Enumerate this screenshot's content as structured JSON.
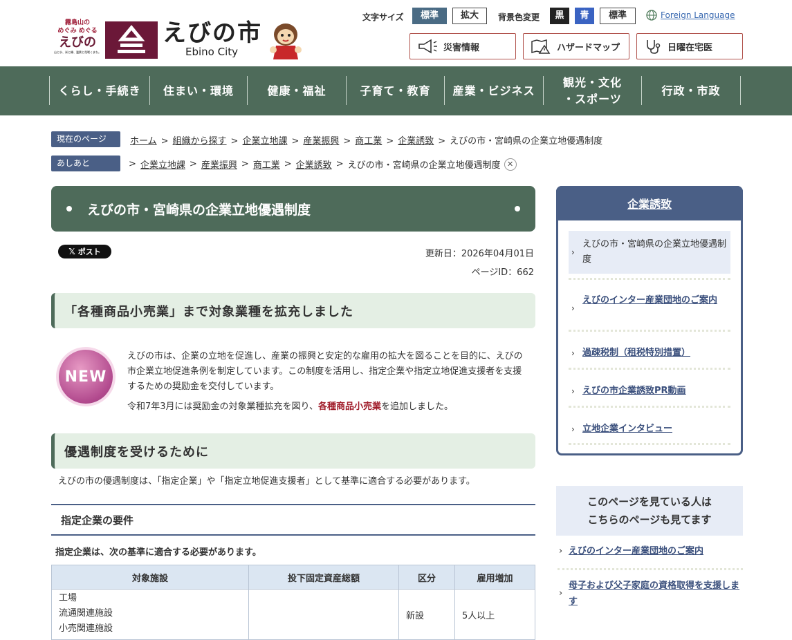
{
  "header": {
    "slogan_top": "霧島山の",
    "slogan_mid": "めぐみ めぐる",
    "slogan_city": "えびの",
    "slogan_small": "山と水、米と緑、温泉と花咲くまち。",
    "city_name": "えびの市",
    "city_name_en": "Ebino City",
    "font_size_label": "文字サイズ",
    "font_size_options": [
      "標準",
      "拡大"
    ],
    "bg_color_label": "背景色変更",
    "bg_color_options": [
      "黒",
      "青",
      "標準"
    ],
    "foreign_language": "Foreign Language",
    "service_buttons": [
      {
        "label": "災害情報",
        "icon": "megaphone-icon"
      },
      {
        "label": "ハザードマップ",
        "icon": "map-warning-icon"
      },
      {
        "label": "日曜在宅医",
        "icon": "stethoscope-icon"
      }
    ]
  },
  "nav": {
    "items": [
      "くらし・手続き",
      "住まい・環境",
      "健康・福祉",
      "子育て・教育",
      "産業・ビジネス",
      "観光・文化\n・スポーツ",
      "行政・市政"
    ]
  },
  "breadcrumb": {
    "current_label": "現在のページ",
    "current_links": [
      "ホーム",
      "組織から探す",
      "企業立地課",
      "産業振興",
      "商工業",
      "企業誘致"
    ],
    "current_page": "えびの市・宮崎県の企業立地優遇制度",
    "history_label": "あしあと",
    "history_links": [
      "企業立地課",
      "産業振興",
      "商工業",
      "企業誘致"
    ],
    "history_page": "えびの市・宮崎県の企業立地優遇制度"
  },
  "main": {
    "title": "えびの市・宮崎県の企業立地優遇制度",
    "x_post": "ポスト",
    "updated": "更新日：2026年04月01日",
    "page_id": "ページID：662",
    "section1_title": "「各種商品小売業」まで対象業種を拡充しました",
    "new_badge": "NEW",
    "intro": "えびの市は、企業の立地を促進し、産業の振興と安定的な雇用の拡大を図ることを目的に、えびの市企業立地促進条例を制定しています。この制度を活用し、指定企業や指定立地促進支援者を支援するための奨励金を交付しています。",
    "notice_before": "令和7年3月には奨励金の対象業種拡充を図り、",
    "notice_highlight": "各種商品小売業",
    "notice_after": "を追加しました。",
    "section2_title": "優遇制度を受けるために",
    "section2_text": "えびの市の優遇制度は、「指定企業」や「指定立地促進支援者」として基準に適合する必要があります。",
    "section3_title": "指定企業の要件",
    "section3_lead": "指定企業は、次の基準に適合する必要があります。",
    "table": {
      "headers": [
        "対象施設",
        "投下固定資産総額",
        "区分",
        "雇用増加"
      ],
      "row1": {
        "facilities": [
          "工場",
          "流通関連施設",
          "小売関連施設"
        ],
        "amount": "",
        "category": "新設",
        "employment": "5人以上"
      }
    }
  },
  "sidebar": {
    "title": "企業誘致",
    "items": [
      {
        "label": "えびの市・宮崎県の企業立地優遇制度",
        "current": true
      },
      {
        "label": "えびのインター産業団地のご案内"
      },
      {
        "label": "過疎税制（租税特別措置）"
      },
      {
        "label": "えびの市企業誘致PR動画"
      },
      {
        "label": "立地企業インタビュー"
      }
    ],
    "also_title": "このページを見ている人は\nこちらのページも見てます",
    "also_items": [
      "えびのインター産業団地のご案内",
      "母子および父子家庭の資格取得を支援します"
    ]
  }
}
